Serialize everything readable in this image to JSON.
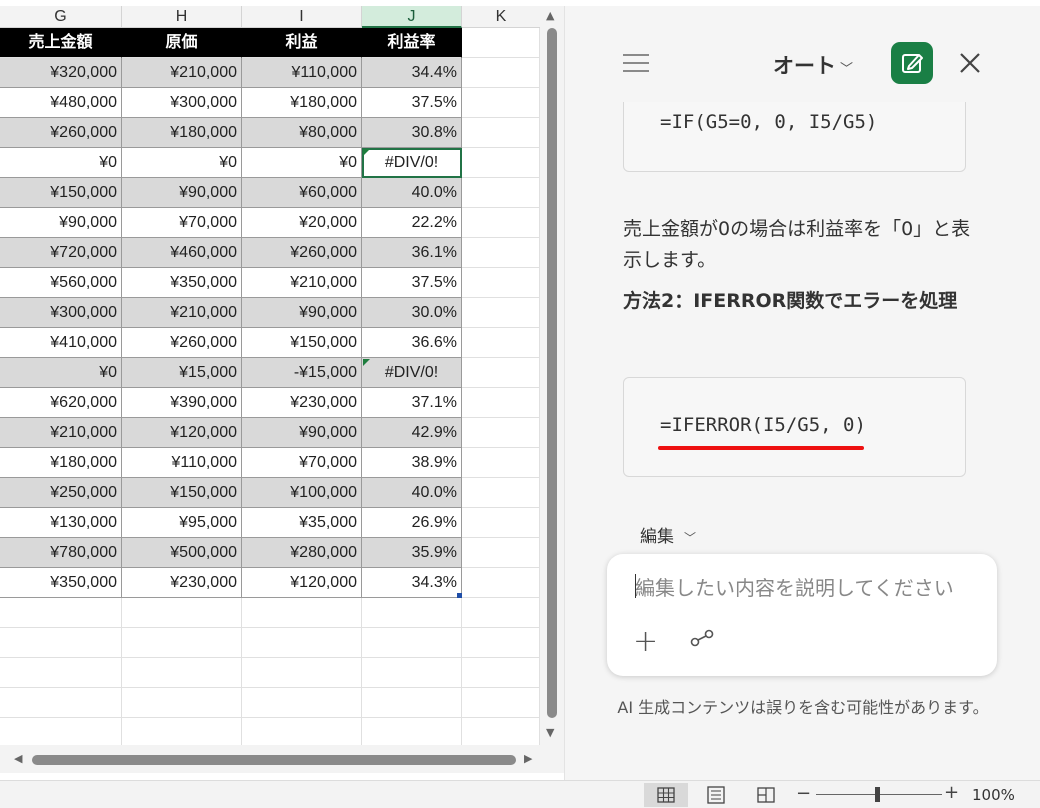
{
  "sheet": {
    "column_letters": [
      "G",
      "H",
      "I",
      "J",
      "K"
    ],
    "selected_column": "J",
    "headers": [
      "売上金額",
      "原価",
      "利益",
      "利益率"
    ],
    "rows": [
      [
        "¥320,000",
        "¥210,000",
        "¥110,000",
        "34.4%"
      ],
      [
        "¥480,000",
        "¥300,000",
        "¥180,000",
        "37.5%"
      ],
      [
        "¥260,000",
        "¥180,000",
        "¥80,000",
        "30.8%"
      ],
      [
        "¥0",
        "¥0",
        "¥0",
        "#DIV/0!"
      ],
      [
        "¥150,000",
        "¥90,000",
        "¥60,000",
        "40.0%"
      ],
      [
        "¥90,000",
        "¥70,000",
        "¥20,000",
        "22.2%"
      ],
      [
        "¥720,000",
        "¥460,000",
        "¥260,000",
        "36.1%"
      ],
      [
        "¥560,000",
        "¥350,000",
        "¥210,000",
        "37.5%"
      ],
      [
        "¥300,000",
        "¥210,000",
        "¥90,000",
        "30.0%"
      ],
      [
        "¥410,000",
        "¥260,000",
        "¥150,000",
        "36.6%"
      ],
      [
        "¥0",
        "¥15,000",
        "-¥15,000",
        "#DIV/0!"
      ],
      [
        "¥620,000",
        "¥390,000",
        "¥230,000",
        "37.1%"
      ],
      [
        "¥210,000",
        "¥120,000",
        "¥90,000",
        "42.9%"
      ],
      [
        "¥180,000",
        "¥110,000",
        "¥70,000",
        "38.9%"
      ],
      [
        "¥250,000",
        "¥150,000",
        "¥100,000",
        "40.0%"
      ],
      [
        "¥130,000",
        "¥95,000",
        "¥35,000",
        "26.9%"
      ],
      [
        "¥780,000",
        "¥500,000",
        "¥280,000",
        "35.9%"
      ],
      [
        "¥350,000",
        "¥230,000",
        "¥120,000",
        "34.3%"
      ]
    ]
  },
  "copilot": {
    "mode_label": "オート",
    "formula_1": "=IF(G5=0, 0, I5/G5)",
    "explanation": "売上金額が0の場合は利益率を「0」と表示します。",
    "method2_heading": "方法2：IFERROR関数でエラーを処理",
    "formula_2": "=IFERROR(I5/G5, 0)",
    "edit_label": "編集",
    "input_placeholder": "編集したい内容を説明してください",
    "disclaimer": "AI 生成コンテンツは誤りを含む可能性があります。",
    "accent_color": "#1a7f45"
  },
  "status_bar": {
    "zoom_minus": "−",
    "zoom_plus": "+",
    "zoom_level": "100%"
  }
}
